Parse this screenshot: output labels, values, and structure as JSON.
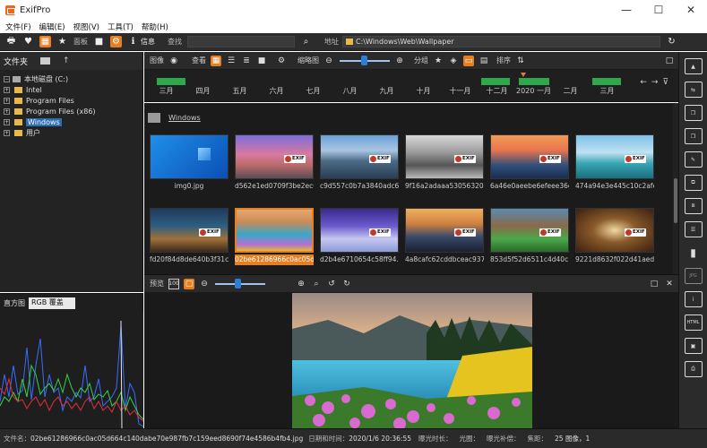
{
  "window": {
    "title": "ExifPro",
    "minimize": "—",
    "maximize": "☐",
    "close": "✕"
  },
  "menu": [
    "文件(F)",
    "编辑(E)",
    "视图(V)",
    "工具(T)",
    "帮助(H)"
  ],
  "toolbar": {
    "panel_label": "面板",
    "info_label": "信息",
    "search_label": "查找",
    "address_label": "地址",
    "address_value": "C:\\Windows\\Web\\Wallpaper"
  },
  "folders": {
    "header": "文件夹",
    "items": [
      {
        "label": "本地磁盘 (C:)",
        "level": 0,
        "expander": "−"
      },
      {
        "label": "Intel",
        "level": 1,
        "expander": "+"
      },
      {
        "label": "Program Files",
        "level": 1,
        "expander": "+"
      },
      {
        "label": "Program Files (x86)",
        "level": 1,
        "expander": "+"
      },
      {
        "label": "Windows",
        "level": 1,
        "expander": "+",
        "selected": true
      },
      {
        "label": "用户",
        "level": 1,
        "expander": "+"
      }
    ]
  },
  "histogram": {
    "label": "直方图",
    "mode": "RGB 覆盖"
  },
  "view_toolbar": {
    "image_label": "图像",
    "view_label": "查看",
    "thumb_label": "缩略图",
    "group_label": "分组",
    "sort_label": "排序"
  },
  "timeline": {
    "months": [
      "三月",
      "四月",
      "五月",
      "六月",
      "七月",
      "八月",
      "九月",
      "十月",
      "十一月",
      "十二月",
      "2020 一月",
      "二月",
      "三月"
    ]
  },
  "browser": {
    "folder": "Windows",
    "thumbnails": [
      {
        "caption": "img0.jpg",
        "badge": false
      },
      {
        "caption": "d562e1ed0709f3be2ec0...",
        "badge": true,
        "badge_text": "EXIF"
      },
      {
        "caption": "c9d557c0b7a3840adc6...",
        "badge": true,
        "badge_text": "EXIF"
      },
      {
        "caption": "9f16a2adaaa530563203...",
        "badge": true,
        "badge_text": "EXIF"
      },
      {
        "caption": "6a46e0aeebe6efeee36ec...",
        "badge": true,
        "badge_text": "EXIF"
      },
      {
        "caption": "474a94e3e445c10c2afe...",
        "badge": true,
        "badge_text": "EXIF"
      },
      {
        "caption": "fd20f84d8de640b3f31c...",
        "badge": true,
        "badge_text": "EXIF"
      },
      {
        "caption": "02be61286966c0ac05d...",
        "badge": false,
        "selected": true
      },
      {
        "caption": "d2b4e6710654c58ff94...",
        "badge": true,
        "badge_text": "EXIF"
      },
      {
        "caption": "4a8cafc62cddbceac937...",
        "badge": true,
        "badge_text": "EXIF"
      },
      {
        "caption": "853d5f52d6511c4d40c...",
        "badge": true,
        "badge_text": "EXIF"
      },
      {
        "caption": "9221d8632f022d41aed...",
        "badge": true,
        "badge_text": "EXIF"
      }
    ]
  },
  "preview": {
    "label": "预览",
    "ratio_label": "100"
  },
  "status": {
    "file_label": "文件名：",
    "file_value": "02be61286966c0ac05d664c140dabe70e987fb7c159eed8690f74e4586b4fb4.jpg",
    "date_label": "日期和时间：",
    "date_value": "2020/1/6  20:36:55",
    "exposure_label": "曝光时长：",
    "aperture_label": "光圈：",
    "comp_label": "曝光补偿：",
    "focal_label": "焦距：",
    "count": "25 图像，1"
  },
  "right_bar": [
    "image-icon",
    "adjust-icon",
    "copy-icon",
    "copy2-icon",
    "edit-icon",
    "resize-icon",
    "crop-icon",
    "sliders-icon",
    "chart-icon",
    "jpg-icon",
    "info-icon",
    "html-icon",
    "slideshow-icon",
    "print-icon"
  ]
}
